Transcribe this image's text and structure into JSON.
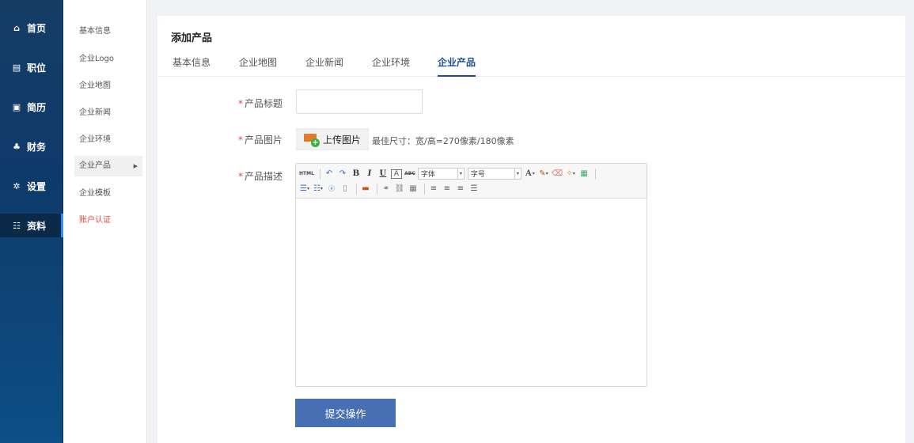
{
  "nav": {
    "items": [
      {
        "icon": "home-icon",
        "glyph": "⌂",
        "label": "首页"
      },
      {
        "icon": "briefcase-icon",
        "glyph": "▤",
        "label": "职位"
      },
      {
        "icon": "resume-icon",
        "glyph": "▣",
        "label": "简历"
      },
      {
        "icon": "finance-icon",
        "glyph": "♣",
        "label": "财务"
      },
      {
        "icon": "gear-icon",
        "glyph": "✲",
        "label": "设置"
      },
      {
        "icon": "profile-icon",
        "glyph": "☷",
        "label": "资料"
      }
    ],
    "active": "资料"
  },
  "submenu": {
    "items": [
      {
        "label": "基本信息"
      },
      {
        "label": "企业Logo"
      },
      {
        "label": "企业地图"
      },
      {
        "label": "企业新闻"
      },
      {
        "label": "企业环境"
      },
      {
        "label": "企业产品"
      },
      {
        "label": "企业模板"
      },
      {
        "label": "账户认证"
      }
    ],
    "active": "企业产品",
    "active_arrow": "▶",
    "highlight_color": "#e34a3e"
  },
  "page": {
    "title": "添加产品",
    "tabs": [
      {
        "label": "基本信息"
      },
      {
        "label": "企业地图"
      },
      {
        "label": "企业新闻"
      },
      {
        "label": "企业环境"
      },
      {
        "label": "企业产品"
      }
    ],
    "active_tab": "企业产品"
  },
  "form": {
    "required_mark": "*",
    "title_label": "产品标题",
    "title_value": "",
    "image_label": "产品图片",
    "upload_label": "上传图片",
    "upload_plus": "+",
    "size_hint": "最佳尺寸：宽/高=270像素/180像素",
    "desc_label": "产品描述",
    "submit_label": "提交操作"
  },
  "editor": {
    "html_label": "HTML",
    "bold": "B",
    "italic": "I",
    "underline": "U",
    "strike_a": "A",
    "abc": "ABC",
    "font_select": "字体",
    "size_select": "字号",
    "font_color": "A",
    "dropdown_arrow": "▾"
  },
  "colors": {
    "accent": "#1f4f8a",
    "submit": "#4670b3",
    "required": "#e34a3e"
  }
}
